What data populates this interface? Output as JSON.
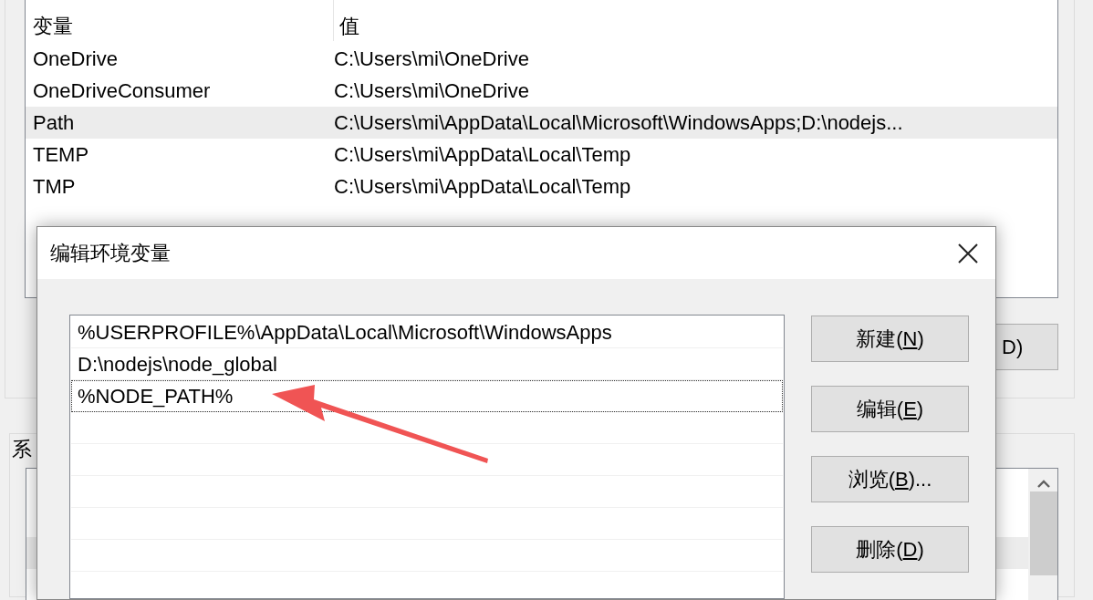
{
  "user_variables": {
    "columns": [
      "变量",
      "值"
    ],
    "rows": [
      {
        "name": "OneDrive",
        "value": "C:\\Users\\mi\\OneDrive",
        "selected": false
      },
      {
        "name": "OneDriveConsumer",
        "value": "C:\\Users\\mi\\OneDrive",
        "selected": false
      },
      {
        "name": "Path",
        "value": "C:\\Users\\mi\\AppData\\Local\\Microsoft\\WindowsApps;D:\\nodejs...",
        "selected": true
      },
      {
        "name": "TEMP",
        "value": "C:\\Users\\mi\\AppData\\Local\\Temp",
        "selected": false
      },
      {
        "name": "TMP",
        "value": "C:\\Users\\mi\\AppData\\Local\\Temp",
        "selected": false
      }
    ],
    "button_label": "D)"
  },
  "system_variables": {
    "group_label": "系",
    "rows": [
      {
        "selected": false
      },
      {
        "selected": true
      },
      {
        "selected": false
      }
    ]
  },
  "dialog": {
    "title": "编辑环境变量",
    "entries": [
      {
        "text": "%USERPROFILE%\\AppData\\Local\\Microsoft\\WindowsApps",
        "focused": false
      },
      {
        "text": "D:\\nodejs\\node_global",
        "focused": false
      },
      {
        "text": "%NODE_PATH%",
        "focused": true
      }
    ],
    "buttons": [
      {
        "before": "新建(",
        "key": "N",
        "after": ")"
      },
      {
        "before": "编辑(",
        "key": "E",
        "after": ")"
      },
      {
        "before": "浏览(",
        "key": "B",
        "after": ")..."
      },
      {
        "before": "删除(",
        "key": "D",
        "after": ")"
      }
    ]
  }
}
